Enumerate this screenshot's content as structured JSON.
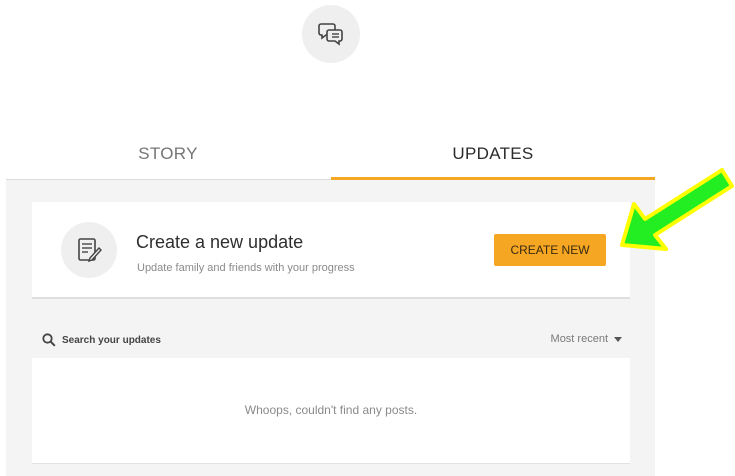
{
  "icons": {
    "top": "speech-bubbles-icon",
    "card": "notepad-edit-icon",
    "search": "search-icon",
    "sort_caret": "caret-down-icon",
    "annotation": "green-arrow-icon"
  },
  "tabs": [
    {
      "label": "STORY",
      "active": false
    },
    {
      "label": "UPDATES",
      "active": true
    }
  ],
  "create_card": {
    "title": "Create a new update",
    "subtitle": "Update family and friends with your progress",
    "button_label": "CREATE NEW"
  },
  "search": {
    "placeholder": "Search your updates",
    "sort_label": "Most recent"
  },
  "empty_message": "Whoops, couldn't find any posts.",
  "colors": {
    "accent": "#f5a623",
    "panel_bg": "#f4f4f4",
    "arrow_fill": "#22ee22",
    "arrow_outline": "#ffff00"
  }
}
